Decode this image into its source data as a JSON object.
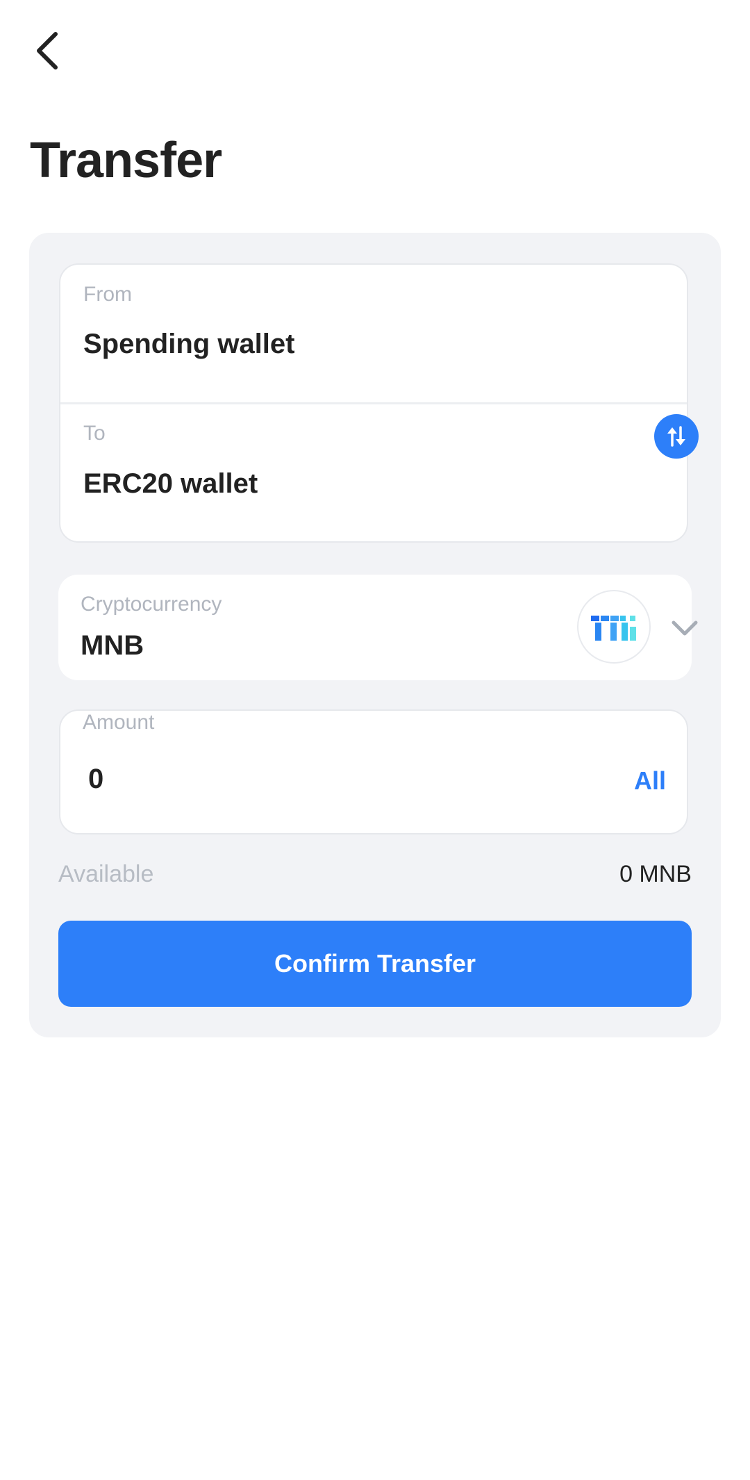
{
  "header": {
    "back_icon": "chevron-left-icon",
    "title": "Transfer"
  },
  "wallets": {
    "from_label": "From",
    "from_value": "Spending wallet",
    "to_label": "To",
    "to_value": "ERC20 wallet",
    "swap_icon": "swap-arrows-icon"
  },
  "cryptocurrency": {
    "label": "Cryptocurrency",
    "value": "MNB",
    "coin_icon": "mnb-coin-icon",
    "dropdown_icon": "chevron-down-icon"
  },
  "amount": {
    "label": "Amount",
    "value": "0",
    "all_label": "All"
  },
  "available": {
    "label": "Available",
    "value": "0 MNB"
  },
  "actions": {
    "confirm_label": "Confirm Transfer"
  },
  "colors": {
    "accent": "#2d7ff9",
    "panel_bg": "#f2f3f6",
    "text": "#222222",
    "muted": "#b0b5be"
  }
}
